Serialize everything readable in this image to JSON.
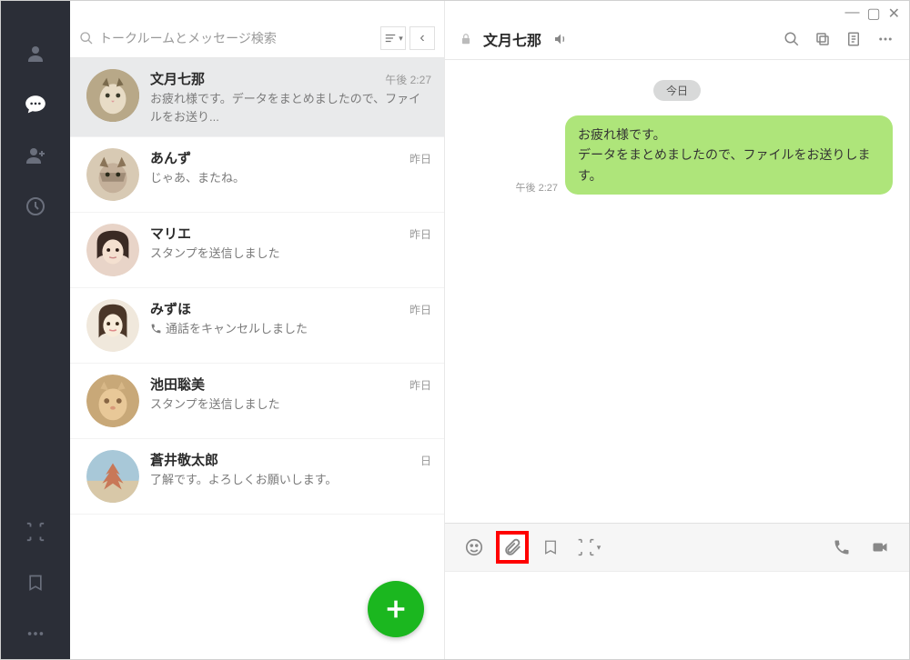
{
  "search": {
    "placeholder": "トークルームとメッセージ検索"
  },
  "chats": [
    {
      "name": "文月七那",
      "time": "午後 2:27",
      "preview": "お疲れ様です。データをまとめましたので、ファイルをお送り..."
    },
    {
      "name": "あんず",
      "time": "昨日",
      "preview": "じゃあ、またね。"
    },
    {
      "name": "マリエ",
      "time": "昨日",
      "preview": "スタンプを送信しました"
    },
    {
      "name": "みずほ",
      "time": "昨日",
      "preview": "通話をキャンセルしました",
      "call": true
    },
    {
      "name": "池田聡美",
      "time": "昨日",
      "preview": "スタンプを送信しました"
    },
    {
      "name": "蒼井敬太郎",
      "time": "日",
      "preview": "了解です。よろしくお願いします。"
    }
  ],
  "conversation": {
    "title": "文月七那",
    "date_label": "今日",
    "msg_time": "午後 2:27",
    "msg_line1": "お疲れ様です。",
    "msg_line2": "データをまとめましたので、ファイルをお送りします。"
  }
}
